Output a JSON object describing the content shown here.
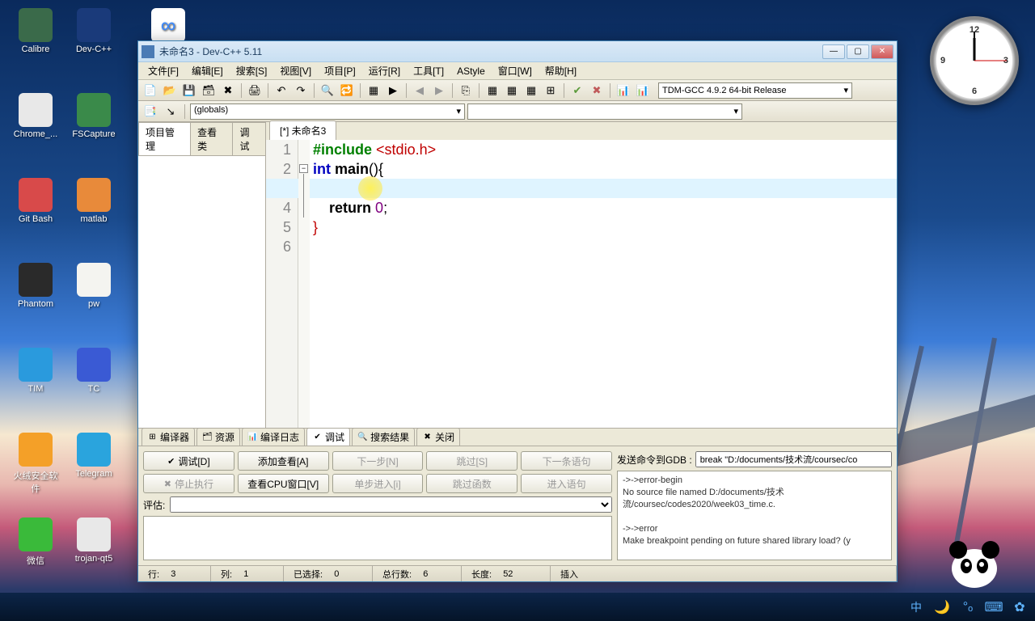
{
  "desktop_icons": [
    {
      "label": "Calibre",
      "col": 0,
      "row": 0,
      "bg": "#3a6a4a"
    },
    {
      "label": "Dev-C++",
      "col": 1,
      "row": 0,
      "bg": "#1a3a7a"
    },
    {
      "label": "Chrome_...",
      "col": 0,
      "row": 1,
      "bg": "#e8e8e8"
    },
    {
      "label": "FSCapture",
      "col": 1,
      "row": 1,
      "bg": "#3a8a4a"
    },
    {
      "label": "Git Bash",
      "col": 0,
      "row": 2,
      "bg": "#d84a4a"
    },
    {
      "label": "matlab",
      "col": 1,
      "row": 2,
      "bg": "#e88a3a"
    },
    {
      "label": "Phantom",
      "col": 0,
      "row": 3,
      "bg": "#2a2a2a"
    },
    {
      "label": "pw",
      "col": 1,
      "row": 3,
      "bg": "#f4f4f0"
    },
    {
      "label": "TIM",
      "col": 0,
      "row": 4,
      "bg": "#2a9add"
    },
    {
      "label": "TC",
      "col": 1,
      "row": 4,
      "bg": "#3a5ad4"
    },
    {
      "label": "火绒安全软件",
      "col": 0,
      "row": 5,
      "bg": "#f4a028"
    },
    {
      "label": "Telegram",
      "col": 1,
      "row": 5,
      "bg": "#2aa4dd"
    },
    {
      "label": "微信",
      "col": 0,
      "row": 6,
      "bg": "#3aba3a"
    },
    {
      "label": "trojan-qt5",
      "col": 1,
      "row": 6,
      "bg": "#e8e8e8"
    }
  ],
  "baidu_icon_bg": "#fff",
  "window": {
    "title": "未命名3 - Dev-C++ 5.11",
    "menus": [
      "文件[F]",
      "编辑[E]",
      "搜索[S]",
      "视图[V]",
      "项目[P]",
      "运行[R]",
      "工具[T]",
      "AStyle",
      "窗口[W]",
      "帮助[H]"
    ],
    "compiler": "TDM-GCC 4.9.2 64-bit Release",
    "globals": "(globals)",
    "left_tabs": [
      "项目管理",
      "查看类",
      "调试"
    ],
    "file_tab": "[*] 未命名3",
    "code_lines": [
      {
        "n": 1,
        "html": "<span class='kw-green'>#include</span> <span class='kw-red'>&lt;stdio.h&gt;</span>"
      },
      {
        "n": 2,
        "html": "<span class='kw-blue'>int</span> <span class='kw-black'>main</span>(){"
      },
      {
        "n": 3,
        "html": "    "
      },
      {
        "n": 4,
        "html": "    <span class='kw-black'>return</span> <span class='kw-purple'>0</span>;"
      },
      {
        "n": 5,
        "html": "<span class='kw-red'>}</span>"
      },
      {
        "n": 6,
        "html": ""
      }
    ],
    "highlight_line_index": 2,
    "bottom_tabs": [
      {
        "label": "编译器",
        "ico": "⊞"
      },
      {
        "label": "资源",
        "ico": "🗂"
      },
      {
        "label": "编译日志",
        "ico": "📊"
      },
      {
        "label": "调试",
        "ico": "✔",
        "active": true
      },
      {
        "label": "搜索结果",
        "ico": "🔍"
      },
      {
        "label": "关闭",
        "ico": "✖"
      }
    ],
    "debug_buttons_row1": [
      {
        "label": "调试[D]",
        "ico": "✔",
        "enabled": true
      },
      {
        "label": "添加查看[A]",
        "enabled": true
      },
      {
        "label": "下一步[N]",
        "enabled": false
      },
      {
        "label": "跳过[S]",
        "enabled": false
      },
      {
        "label": "下一条语句",
        "enabled": false
      }
    ],
    "debug_buttons_row2": [
      {
        "label": "停止执行",
        "ico": "✖",
        "enabled": false
      },
      {
        "label": "查看CPU窗口[V]",
        "enabled": true
      },
      {
        "label": "单步进入[i]",
        "enabled": false
      },
      {
        "label": "跳过函数",
        "enabled": false
      },
      {
        "label": "进入语句",
        "enabled": false
      }
    ],
    "eval_label": "评估:",
    "gdb_label": "发送命令到GDB :",
    "gdb_cmd": "break \"D:/documents/技术流/coursec/co",
    "gdb_output": [
      "->->error-begin",
      "No source file named D:/documents/技术流/coursec/codes2020/week03_time.c.",
      "",
      "->->error",
      "Make breakpoint pending on future shared library load? (y"
    ],
    "status": {
      "line_lbl": "行:",
      "line": "3",
      "col_lbl": "列:",
      "col": "1",
      "sel_lbl": "已选择:",
      "sel": "0",
      "tot_lbl": "总行数:",
      "tot": "6",
      "len_lbl": "长度:",
      "len": "52",
      "mode": "插入"
    }
  },
  "ime_char": "中"
}
